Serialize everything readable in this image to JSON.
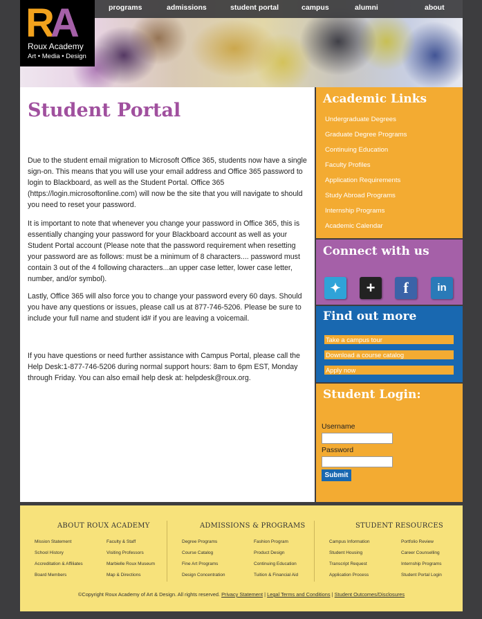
{
  "brand": {
    "mark_r": "R",
    "mark_a": "A",
    "name": "Roux Academy",
    "tagline": "Art • Media • Design"
  },
  "nav": [
    "programs",
    "admissions",
    "student portal",
    "campus",
    "alumni",
    "about"
  ],
  "main": {
    "title": "Student Portal",
    "paragraphs": [
      "Due to the student email migration to Microsoft Office 365, students now have a single sign-on. This means that you will use your email address and Office 365 password to login to Blackboard, as well as the Student Portal. Office 365 (https://login.microsoftonline.com) will now be the site that you will navigate to should you need to reset your password.",
      "It is important to note that whenever you change your password in Office 365, this is essentially changing your password for your Blackboard account as well as your Student Portal account (Please note that the password requirement when resetting your password are as follows: must be a minimum of 8 characters.... password must contain 3 out of the 4 following characters...an upper case letter, lower case letter, number, and/or symbol).",
      "Lastly, Office 365 will also force you to change your password every 60 days. Should you have any questions or issues, please call us at 877-746-5206. Please be sure to include your full name and student id# if you are leaving a voicemail.",
      "If you have questions or need further assistance with Campus Portal, please call the Help Desk:1-877-746-5206 during normal support hours: 8am to 6pm EST, Monday through Friday. You can also email help desk at: helpdesk@roux.org."
    ]
  },
  "sidebar": {
    "academic": {
      "title": "Academic Links",
      "links": [
        "Undergraduate Degrees",
        "Graduate Degree Programs",
        "Continuing Education",
        "Faculty Profiles",
        "Application Requirements",
        "Study Abroad Programs",
        "Internship Programs",
        "Academic Calendar"
      ]
    },
    "connect": {
      "title": "Connect with us",
      "icons": [
        "twitter-icon",
        "google-plus-icon",
        "facebook-icon",
        "linkedin-icon"
      ]
    },
    "findout": {
      "title": "Find out more",
      "links": [
        "Take a campus tour",
        "Download a course catalog",
        "Apply now"
      ]
    },
    "login": {
      "title": "Student Login:",
      "username_label": "Username",
      "password_label": "Password",
      "submit_label": "Submit"
    }
  },
  "footer": {
    "columns": [
      {
        "title": "ABOUT ROUX ACADEMY",
        "links": [
          "Mission Statement",
          "Faculty & Staff",
          "School History",
          "Visiting Professors",
          "Accreditation & Affiliates",
          "Marbielle Roux Museum",
          "Board Members",
          "Map & Directions"
        ]
      },
      {
        "title": "ADMISSIONS & PROGRAMS",
        "links": [
          "Degree Programs",
          "Fashion Program",
          "Course Catalog",
          "Product Design",
          "Fine Art Programs",
          "Continuing Education",
          "Design Concentration",
          "Tuition & Financial Aid"
        ]
      },
      {
        "title": "STUDENT RESOURCES",
        "links": [
          "Campus Information",
          "Portfolio Review",
          "Student Housing",
          "Career Counselling",
          "Transcript Request",
          "Internship Programs",
          "Application Process",
          "Student Portal Login"
        ]
      }
    ],
    "copyright": "©Copyright Roux Academy of Art & Design. All rights reserved.",
    "legal_links": [
      "Privacy Statement",
      "Legal Terms and Conditions",
      "Student Outcomes/Disclosures"
    ],
    "separator": "|"
  },
  "colors": {
    "orange": "#f3ab32",
    "purple": "#a560a8",
    "blue": "#1968b0",
    "footer": "#f7e27b",
    "background": "#3d3d3f"
  }
}
